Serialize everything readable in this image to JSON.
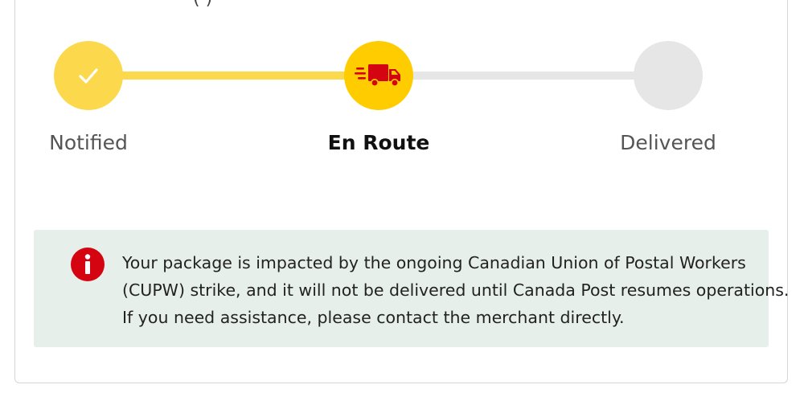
{
  "header": {
    "clipped_text": "(              )"
  },
  "tracker": {
    "steps": [
      {
        "label": "Notified",
        "status": "done",
        "icon": "check-icon"
      },
      {
        "label": "En Route",
        "status": "current",
        "icon": "delivery-truck-icon"
      },
      {
        "label": "Delivered",
        "status": "pending",
        "icon": ""
      }
    ]
  },
  "alert": {
    "icon": "info-icon",
    "lines": [
      "Your package is impacted by the ongoing Canadian Union of Postal Workers",
      "(CUPW) strike, and it will not be delivered until Canada Post resumes operations.",
      "If you need assistance, please contact the merchant directly."
    ]
  },
  "colors": {
    "accent_yellow": "#ffcc00",
    "light_yellow": "#fcd94c",
    "brand_red": "#d40511",
    "pending_gray": "#e6e6e6",
    "alert_background": "#e7efea"
  }
}
